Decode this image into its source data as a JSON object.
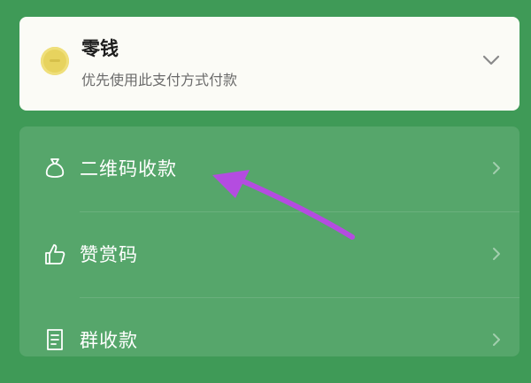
{
  "payment": {
    "title": "零钱",
    "subtitle": "优先使用此支付方式付款",
    "coin_icon": "coin-icon",
    "chevron_icon": "chevron-down-icon"
  },
  "menu": {
    "items": [
      {
        "label": "二维码收款",
        "icon": "money-bag-icon"
      },
      {
        "label": "赞赏码",
        "icon": "thumbs-up-icon"
      },
      {
        "label": "群收款",
        "icon": "document-icon"
      }
    ]
  },
  "colors": {
    "background": "#3f9a57",
    "card": "#fbfbf6",
    "coin": "#e7d35e",
    "annotation_arrow": "#b44ce0"
  }
}
